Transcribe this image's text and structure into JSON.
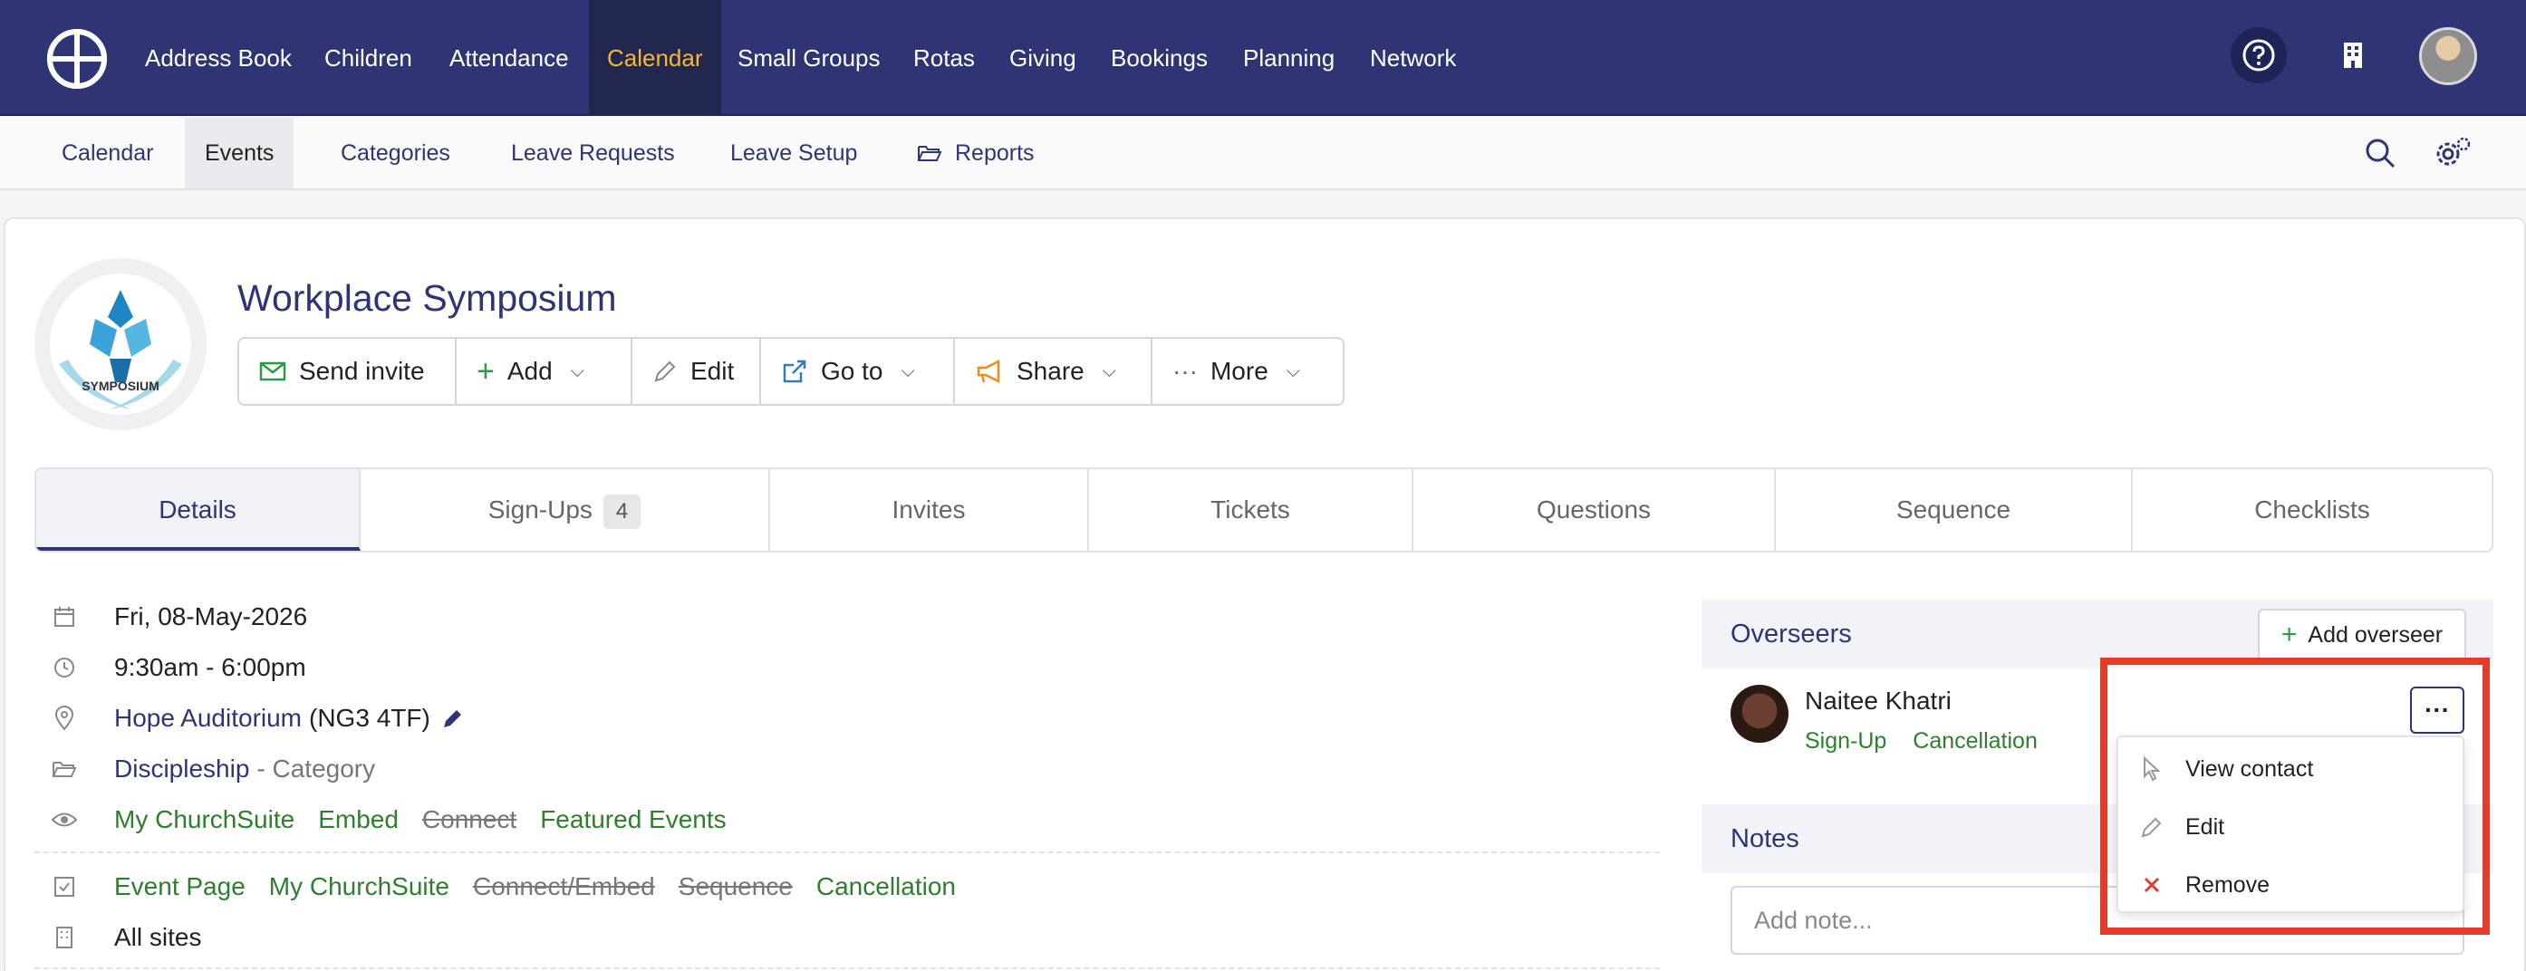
{
  "topnav": {
    "items": [
      "Address Book",
      "Children",
      "Attendance",
      "Calendar",
      "Small Groups",
      "Rotas",
      "Giving",
      "Bookings",
      "Planning",
      "Network"
    ],
    "active": "Calendar",
    "icons": [
      "help-icon",
      "building-icon",
      "avatar"
    ]
  },
  "subnav": {
    "items": [
      "Calendar",
      "Events",
      "Categories",
      "Leave Requests",
      "Leave Setup",
      "Reports"
    ],
    "active": "Events",
    "icons": [
      "search-icon",
      "settings-icon"
    ]
  },
  "event": {
    "title": "Workplace Symposium",
    "logo_text": "SYMPOSIUM"
  },
  "toolbar": {
    "send_invite": "Send invite",
    "add": "Add",
    "edit": "Edit",
    "goto": "Go to",
    "share": "Share",
    "more": "More"
  },
  "tabs": [
    {
      "label": "Details"
    },
    {
      "label": "Sign-Ups",
      "badge": "4"
    },
    {
      "label": "Invites"
    },
    {
      "label": "Tickets"
    },
    {
      "label": "Questions"
    },
    {
      "label": "Sequence"
    },
    {
      "label": "Checklists"
    }
  ],
  "details": {
    "date": "Fri, 08-May-2026",
    "time": "9:30am - 6:00pm",
    "location_name": "Hope Auditorium",
    "location_postcode": "(NG3 4TF)",
    "category_name": "Discipleship",
    "category_suffix": "- Category",
    "visibility": {
      "my_churchsuite": "My ChurchSuite",
      "embed": "Embed",
      "connect": "Connect",
      "featured": "Featured Events"
    },
    "features": {
      "event_page": "Event Page",
      "my_churchsuite": "My ChurchSuite",
      "connect_embed": "Connect/Embed",
      "sequence": "Sequence",
      "cancellation": "Cancellation"
    },
    "sites": "All sites"
  },
  "overseers": {
    "title": "Overseers",
    "add_label": "Add overseer",
    "person": {
      "name": "Naitee Khatri",
      "link1": "Sign-Up",
      "link2": "Cancellation"
    },
    "menu": {
      "view_contact": "View contact",
      "edit": "Edit",
      "remove": "Remove"
    }
  },
  "notes": {
    "title": "Notes",
    "placeholder": "Add note..."
  },
  "colors": {
    "brand_navy": "#2f3574",
    "active_nav": "#f5b731",
    "green_link": "#2f7d2f",
    "highlight_red": "#e53b2b"
  }
}
